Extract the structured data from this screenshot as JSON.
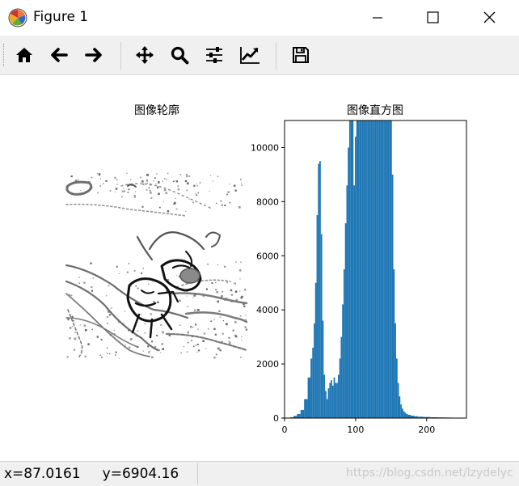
{
  "window": {
    "title": "Figure 1"
  },
  "toolbar": {
    "buttons": [
      {
        "name": "home",
        "icon": "home-icon"
      },
      {
        "name": "back",
        "icon": "arrow-left-icon"
      },
      {
        "name": "forward",
        "icon": "arrow-right-icon"
      },
      {
        "name": "pan",
        "icon": "move-icon"
      },
      {
        "name": "zoom",
        "icon": "magnifier-icon"
      },
      {
        "name": "subplots",
        "icon": "sliders-icon"
      },
      {
        "name": "customize",
        "icon": "line-chart-icon"
      },
      {
        "name": "save",
        "icon": "floppy-disk-icon"
      }
    ]
  },
  "figure": {
    "left_title": "图像轮廓",
    "right_title": "图像直方图"
  },
  "chart_data": {
    "type": "bar",
    "title": "图像直方图",
    "xlabel": "",
    "ylabel": "",
    "xlim": [
      0,
      256
    ],
    "ylim": [
      0,
      11000
    ],
    "xticks": [
      "0",
      "100",
      "200"
    ],
    "yticks": [
      "0",
      "2000",
      "4000",
      "6000",
      "8000",
      "10000"
    ],
    "color": "#1f77b4",
    "x": [
      10,
      15,
      20,
      25,
      30,
      35,
      38,
      40,
      42,
      44,
      46,
      48,
      50,
      52,
      54,
      56,
      58,
      60,
      62,
      64,
      66,
      68,
      70,
      72,
      74,
      76,
      78,
      80,
      82,
      84,
      86,
      88,
      90,
      92,
      94,
      96,
      98,
      100,
      102,
      104,
      106,
      108,
      110,
      112,
      114,
      116,
      118,
      120,
      122,
      124,
      126,
      128,
      130,
      132,
      134,
      136,
      138,
      140,
      142,
      144,
      146,
      148,
      150,
      152,
      154,
      156,
      158,
      160,
      162,
      164,
      166,
      168,
      170,
      172,
      175,
      180,
      185,
      190,
      200,
      210,
      220,
      230,
      240,
      250
    ],
    "values": [
      30,
      80,
      150,
      300,
      700,
      1500,
      2200,
      2600,
      3500,
      5000,
      7500,
      9400,
      9500,
      6800,
      3600,
      1600,
      1000,
      700,
      1100,
      1300,
      1400,
      1200,
      1500,
      1300,
      1300,
      1600,
      2200,
      3000,
      4200,
      5500,
      7200,
      8600,
      10000,
      11000,
      11000,
      11000,
      8600,
      10400,
      11000,
      11000,
      11000,
      11000,
      11000,
      11000,
      11000,
      11000,
      11000,
      11000,
      11000,
      11000,
      11000,
      11000,
      11000,
      11000,
      11000,
      11000,
      11000,
      11000,
      11000,
      11000,
      11000,
      11000,
      11000,
      9000,
      5500,
      3500,
      2200,
      1300,
      800,
      500,
      350,
      250,
      200,
      150,
      120,
      90,
      70,
      50,
      40,
      30,
      25,
      20,
      15,
      10
    ]
  },
  "status": {
    "x_label": "x=87.0161",
    "y_label": "y=6904.16",
    "watermark": "https://blog.csdn.net/lzydelyc"
  }
}
